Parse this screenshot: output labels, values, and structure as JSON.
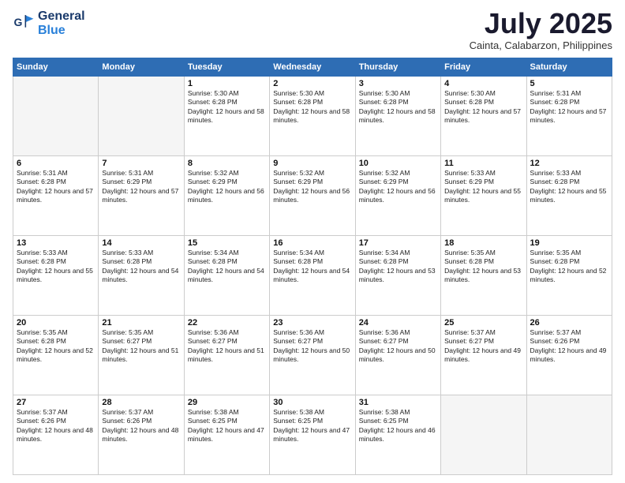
{
  "logo": {
    "line1": "General",
    "line2": "Blue"
  },
  "title": "July 2025",
  "subtitle": "Cainta, Calabarzon, Philippines",
  "days_of_week": [
    "Sunday",
    "Monday",
    "Tuesday",
    "Wednesday",
    "Thursday",
    "Friday",
    "Saturday"
  ],
  "weeks": [
    [
      {
        "day": "",
        "info": ""
      },
      {
        "day": "",
        "info": ""
      },
      {
        "day": "1",
        "info": "Sunrise: 5:30 AM\nSunset: 6:28 PM\nDaylight: 12 hours and 58 minutes."
      },
      {
        "day": "2",
        "info": "Sunrise: 5:30 AM\nSunset: 6:28 PM\nDaylight: 12 hours and 58 minutes."
      },
      {
        "day": "3",
        "info": "Sunrise: 5:30 AM\nSunset: 6:28 PM\nDaylight: 12 hours and 58 minutes."
      },
      {
        "day": "4",
        "info": "Sunrise: 5:30 AM\nSunset: 6:28 PM\nDaylight: 12 hours and 57 minutes."
      },
      {
        "day": "5",
        "info": "Sunrise: 5:31 AM\nSunset: 6:28 PM\nDaylight: 12 hours and 57 minutes."
      }
    ],
    [
      {
        "day": "6",
        "info": "Sunrise: 5:31 AM\nSunset: 6:28 PM\nDaylight: 12 hours and 57 minutes."
      },
      {
        "day": "7",
        "info": "Sunrise: 5:31 AM\nSunset: 6:29 PM\nDaylight: 12 hours and 57 minutes."
      },
      {
        "day": "8",
        "info": "Sunrise: 5:32 AM\nSunset: 6:29 PM\nDaylight: 12 hours and 56 minutes."
      },
      {
        "day": "9",
        "info": "Sunrise: 5:32 AM\nSunset: 6:29 PM\nDaylight: 12 hours and 56 minutes."
      },
      {
        "day": "10",
        "info": "Sunrise: 5:32 AM\nSunset: 6:29 PM\nDaylight: 12 hours and 56 minutes."
      },
      {
        "day": "11",
        "info": "Sunrise: 5:33 AM\nSunset: 6:29 PM\nDaylight: 12 hours and 55 minutes."
      },
      {
        "day": "12",
        "info": "Sunrise: 5:33 AM\nSunset: 6:28 PM\nDaylight: 12 hours and 55 minutes."
      }
    ],
    [
      {
        "day": "13",
        "info": "Sunrise: 5:33 AM\nSunset: 6:28 PM\nDaylight: 12 hours and 55 minutes."
      },
      {
        "day": "14",
        "info": "Sunrise: 5:33 AM\nSunset: 6:28 PM\nDaylight: 12 hours and 54 minutes."
      },
      {
        "day": "15",
        "info": "Sunrise: 5:34 AM\nSunset: 6:28 PM\nDaylight: 12 hours and 54 minutes."
      },
      {
        "day": "16",
        "info": "Sunrise: 5:34 AM\nSunset: 6:28 PM\nDaylight: 12 hours and 54 minutes."
      },
      {
        "day": "17",
        "info": "Sunrise: 5:34 AM\nSunset: 6:28 PM\nDaylight: 12 hours and 53 minutes."
      },
      {
        "day": "18",
        "info": "Sunrise: 5:35 AM\nSunset: 6:28 PM\nDaylight: 12 hours and 53 minutes."
      },
      {
        "day": "19",
        "info": "Sunrise: 5:35 AM\nSunset: 6:28 PM\nDaylight: 12 hours and 52 minutes."
      }
    ],
    [
      {
        "day": "20",
        "info": "Sunrise: 5:35 AM\nSunset: 6:28 PM\nDaylight: 12 hours and 52 minutes."
      },
      {
        "day": "21",
        "info": "Sunrise: 5:35 AM\nSunset: 6:27 PM\nDaylight: 12 hours and 51 minutes."
      },
      {
        "day": "22",
        "info": "Sunrise: 5:36 AM\nSunset: 6:27 PM\nDaylight: 12 hours and 51 minutes."
      },
      {
        "day": "23",
        "info": "Sunrise: 5:36 AM\nSunset: 6:27 PM\nDaylight: 12 hours and 50 minutes."
      },
      {
        "day": "24",
        "info": "Sunrise: 5:36 AM\nSunset: 6:27 PM\nDaylight: 12 hours and 50 minutes."
      },
      {
        "day": "25",
        "info": "Sunrise: 5:37 AM\nSunset: 6:27 PM\nDaylight: 12 hours and 49 minutes."
      },
      {
        "day": "26",
        "info": "Sunrise: 5:37 AM\nSunset: 6:26 PM\nDaylight: 12 hours and 49 minutes."
      }
    ],
    [
      {
        "day": "27",
        "info": "Sunrise: 5:37 AM\nSunset: 6:26 PM\nDaylight: 12 hours and 48 minutes."
      },
      {
        "day": "28",
        "info": "Sunrise: 5:37 AM\nSunset: 6:26 PM\nDaylight: 12 hours and 48 minutes."
      },
      {
        "day": "29",
        "info": "Sunrise: 5:38 AM\nSunset: 6:25 PM\nDaylight: 12 hours and 47 minutes."
      },
      {
        "day": "30",
        "info": "Sunrise: 5:38 AM\nSunset: 6:25 PM\nDaylight: 12 hours and 47 minutes."
      },
      {
        "day": "31",
        "info": "Sunrise: 5:38 AM\nSunset: 6:25 PM\nDaylight: 12 hours and 46 minutes."
      },
      {
        "day": "",
        "info": ""
      },
      {
        "day": "",
        "info": ""
      }
    ]
  ]
}
